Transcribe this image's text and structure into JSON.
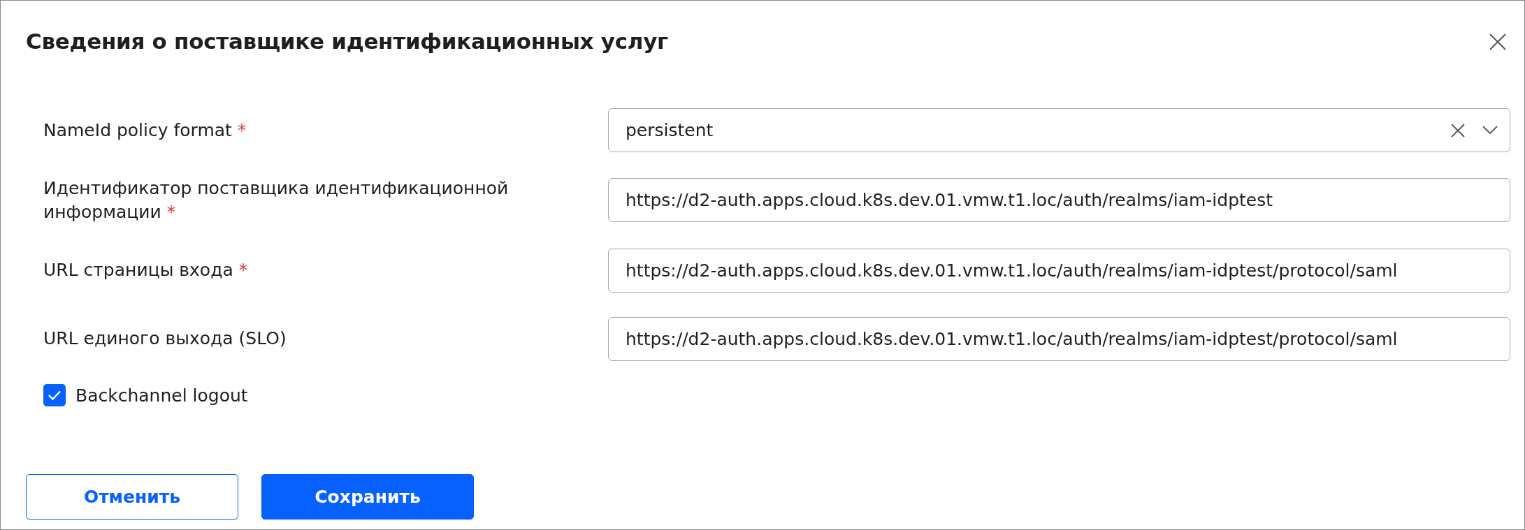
{
  "dialog": {
    "title": "Сведения о поставщике идентификационных услуг"
  },
  "fields": [
    {
      "kind": "select",
      "label": "NameId policy format",
      "required_mark": "*",
      "value": "persistent"
    },
    {
      "kind": "text",
      "label": "Идентификатор поставщика идентификационной информации",
      "required_mark": "*",
      "value": "https://d2-auth.apps.cloud.k8s.dev.01.vmw.t1.loc/auth/realms/iam-idptest"
    },
    {
      "kind": "text",
      "label": "URL страницы входа",
      "required_mark": "*",
      "value": "https://d2-auth.apps.cloud.k8s.dev.01.vmw.t1.loc/auth/realms/iam-idptest/protocol/saml"
    },
    {
      "kind": "text",
      "label": "URL единого выхода (SLO)",
      "value": "https://d2-auth.apps.cloud.k8s.dev.01.vmw.t1.loc/auth/realms/iam-idptest/protocol/saml"
    }
  ],
  "checkbox": {
    "label": "Backchannel logout",
    "checked": true
  },
  "buttons": [
    {
      "kind": "secondary",
      "label": "Отменить"
    },
    {
      "kind": "primary",
      "label": "Сохранить"
    }
  ]
}
